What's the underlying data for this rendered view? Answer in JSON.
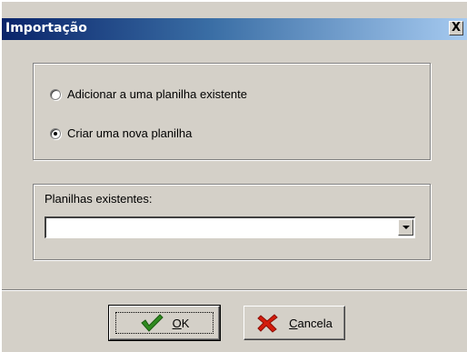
{
  "window": {
    "title": "Importação",
    "close_glyph": "X"
  },
  "options": {
    "add_existing_label": "Adicionar a uma planilha existente",
    "create_new_label": "Criar uma nova planilha",
    "selected": "create_new"
  },
  "sheets": {
    "label": "Planilhas existentes:",
    "selected_value": ""
  },
  "buttons": {
    "ok_label_mnemonic": "O",
    "ok_label_rest": "K",
    "ok_icon": "checkmark-icon",
    "cancel_label_mnemonic": "C",
    "cancel_label_rest": "ancela",
    "cancel_icon": "red-x-icon"
  },
  "colors": {
    "titlebar_start": "#0a246a",
    "titlebar_end": "#a6caf0",
    "dialog_bg": "#d4d0c8",
    "ok_icon": "#2f8a1f",
    "cancel_icon": "#d41c0c"
  }
}
